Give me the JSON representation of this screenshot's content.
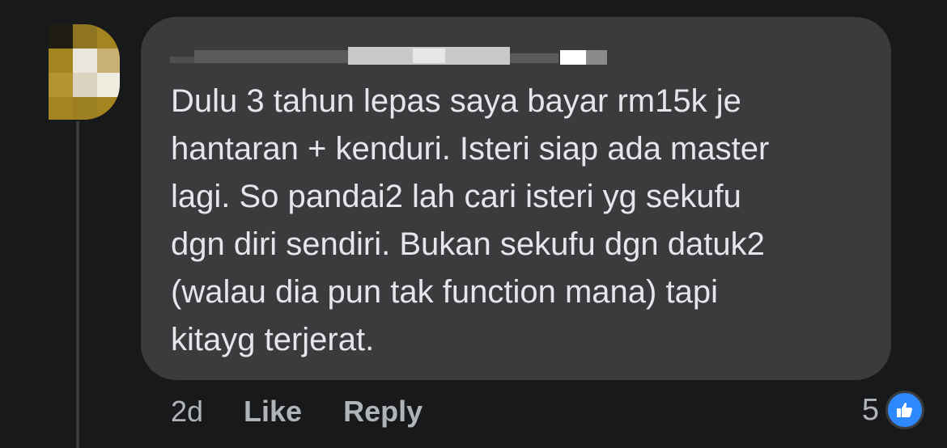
{
  "comment": {
    "author_name": "",
    "text": "Dulu 3 tahun lepas saya bayar rm15k je\nhantaran + kenduri. Isteri siap ada master\nlagi. So pandai2 lah cari isteri yg sekufu\ndgn diri sendiri. Bukan sekufu dgn datuk2\n(walau dia pun tak function mana) tapi\nkitayg terjerat.",
    "timestamp": "2d",
    "reaction_count": "5",
    "reaction_icon": "thumbs-up-icon"
  },
  "actions": {
    "like_label": "Like",
    "reply_label": "Reply"
  },
  "colors": {
    "background": "#18191a",
    "bubble": "#3a3b3c",
    "text": "#e4e6eb",
    "secondary_text": "#b0b3b8",
    "like_blue": "#2e89ff",
    "avatar_gold": "#a3841f"
  }
}
